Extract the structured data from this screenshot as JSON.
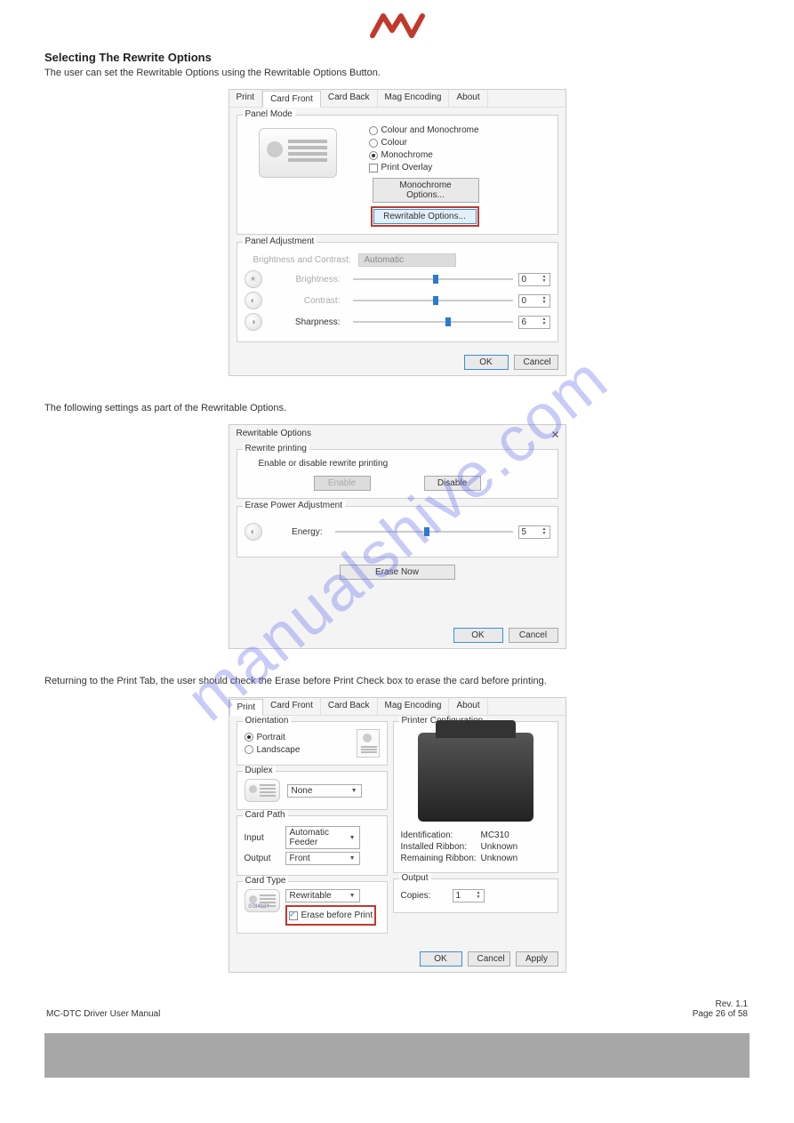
{
  "logo_alt": "Matica logo",
  "watermark": "manualshive.com",
  "section1": {
    "heading": "Selecting The Rewrite Options",
    "desc": "The user can set the Rewritable Options using the Rewritable Options Button."
  },
  "dlg1": {
    "tabs": [
      "Print",
      "Card Front",
      "Card Back",
      "Mag Encoding",
      "About"
    ],
    "active_tab": "Card Front",
    "panel_mode": {
      "legend": "Panel Mode",
      "opt_colour_mono": "Colour and Monochrome",
      "opt_colour": "Colour",
      "opt_mono": "Monochrome",
      "opt_overlay": "Print Overlay",
      "btn_mono": "Monochrome Options...",
      "btn_rewrite": "Rewritable Options..."
    },
    "panel_adj": {
      "legend": "Panel Adjustment",
      "bc_label": "Brightness and Contrast:",
      "bc_value": "Automatic",
      "brightness_label": "Brightness:",
      "brightness_val": "0",
      "contrast_label": "Contrast:",
      "contrast_val": "0",
      "sharpness_label": "Sharpness:",
      "sharpness_val": "6"
    },
    "ok": "OK",
    "cancel": "Cancel"
  },
  "section2": {
    "desc": "The following settings as part of the Rewritable Options."
  },
  "dlg2": {
    "title": "Rewritable Options",
    "rewrite": {
      "legend": "Rewrite printing",
      "desc": "Enable or disable rewrite printing",
      "enable": "Enable",
      "disable": "Disable"
    },
    "erase": {
      "legend": "Erase Power Adjustment",
      "energy_label": "Energy:",
      "energy_val": "5"
    },
    "erase_now": "Erase Now",
    "ok": "OK",
    "cancel": "Cancel"
  },
  "section3": {
    "desc": "Returning to the Print Tab, the user should check the Erase before Print Check box to erase the card before printing."
  },
  "dlg3": {
    "tabs": [
      "Print",
      "Card Front",
      "Card Back",
      "Mag Encoding",
      "About"
    ],
    "active_tab": "Print",
    "orientation": {
      "legend": "Orientation",
      "portrait": "Portrait",
      "landscape": "Landscape"
    },
    "duplex": {
      "legend": "Duplex",
      "value": "None"
    },
    "cardpath": {
      "legend": "Card Path",
      "input_label": "Input",
      "input_value": "Automatic Feeder",
      "output_label": "Output",
      "output_value": "Front"
    },
    "cardtype": {
      "legend": "Card Type",
      "value": "Rewritable",
      "erase_before": "Erase before Print",
      "thumb_text": "0784124"
    },
    "printerconf": {
      "legend": "Printer Configuration",
      "ident_label": "Identification:",
      "ident_val": "MC310",
      "ribbon_label": "Installed Ribbon:",
      "ribbon_val": "Unknown",
      "remain_label": "Remaining Ribbon:",
      "remain_val": "Unknown"
    },
    "output": {
      "legend": "Output",
      "copies_label": "Copies:",
      "copies_val": "1"
    },
    "ok": "OK",
    "cancel": "Cancel",
    "apply": "Apply"
  },
  "footer": {
    "left": "MC-DTC Driver User Manual",
    "right_top": "Rev. 1.1",
    "right_bottom": "Page 26 of 58"
  }
}
